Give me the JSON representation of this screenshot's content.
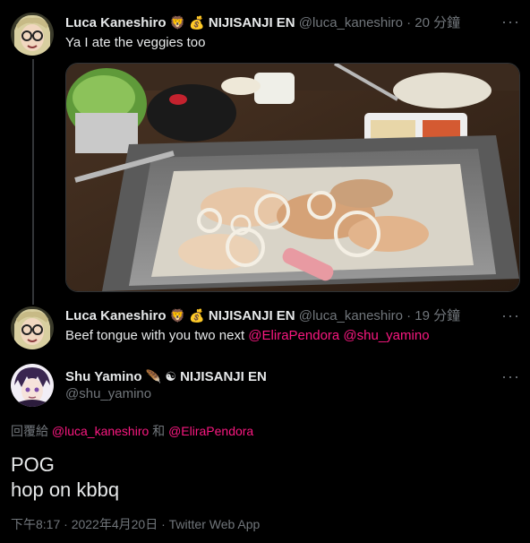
{
  "colors": {
    "background": "#000000",
    "text": "#e7e9ea",
    "muted": "#71767b",
    "mention": "#f91880",
    "line": "#333639"
  },
  "tweet1": {
    "name": "Luca Kaneshiro",
    "emoji1": "🦁",
    "emoji2": "💰",
    "org": "NIJISANJI EN",
    "handle": "@luca_kaneshiro",
    "time": "· 20 分鐘",
    "more": "···",
    "text": "Ya I ate the veggies too"
  },
  "tweet2": {
    "name": "Luca Kaneshiro",
    "emoji1": "🦁",
    "emoji2": "💰",
    "org": "NIJISANJI EN",
    "handle": "@luca_kaneshiro",
    "time": "· 19 分鐘",
    "more": "···",
    "text_prefix": "Beef tongue with you two next ",
    "mention1": "@EliraPendora",
    "mention2": "@shu_yamino"
  },
  "main_tweet": {
    "name": "Shu Yamino",
    "emoji1": "🪶",
    "emoji2": "☯",
    "org": "NIJISANJI EN",
    "handle": "@shu_yamino",
    "more": "···",
    "reply_prefix": "回覆給",
    "reply_mention1": "@luca_kaneshiro",
    "reply_and": "和",
    "reply_mention2": "@EliraPendora",
    "body_line1": "POG",
    "body_line2": "hop on kbbq",
    "meta": "下午8:17 · 2022年4月20日 · Twitter Web App"
  },
  "icons": {
    "avatar1": "luca-avatar-icon",
    "avatar2": "luca-avatar-icon",
    "avatar3": "shu-avatar-icon",
    "more": "more-icon"
  }
}
